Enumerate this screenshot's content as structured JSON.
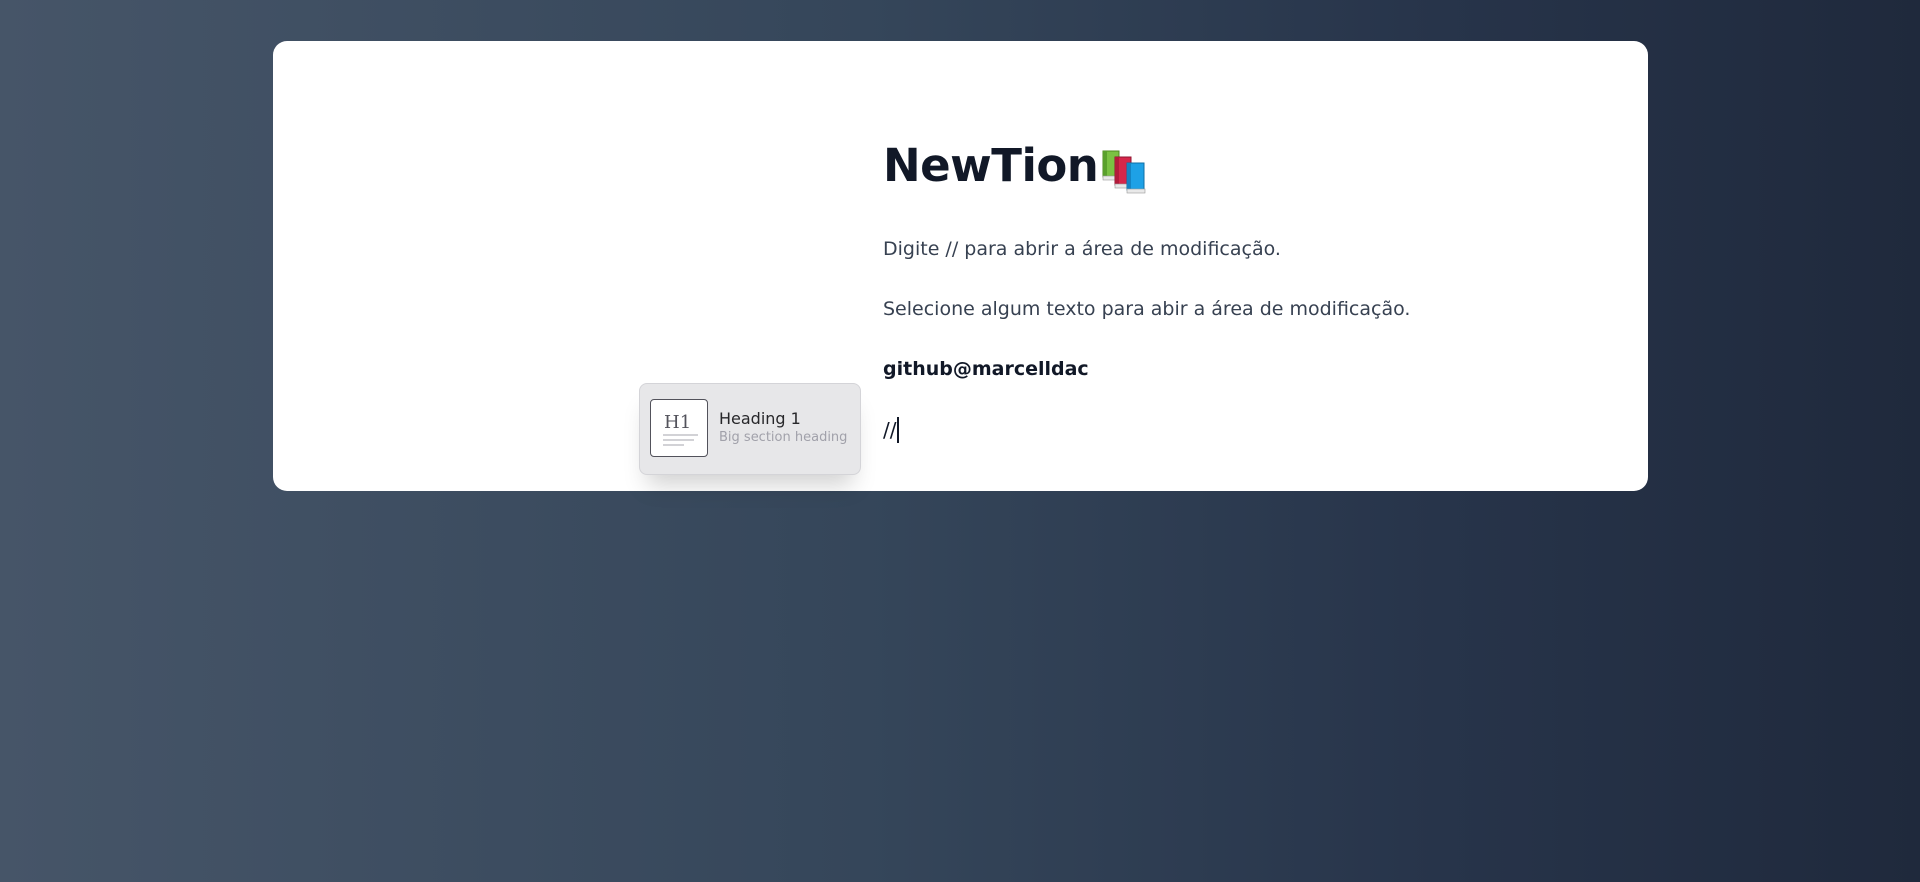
{
  "document": {
    "title": "NewTion",
    "title_icon": "books-icon",
    "paragraphs": [
      "Digite // para abrir a área de modificação.",
      "Selecione algum texto para abir a área de modificação.",
      "github@marcelldac"
    ],
    "editor_line_text": "//"
  },
  "slash_menu": {
    "items": [
      {
        "icon": "heading-1-icon",
        "icon_text": "H1",
        "label": "Heading 1",
        "description": "Big section heading"
      }
    ]
  },
  "colors": {
    "title": "#111827",
    "body_text": "#374151",
    "menu_background": "#e7e7e9",
    "menu_description": "#a1a1aa"
  }
}
